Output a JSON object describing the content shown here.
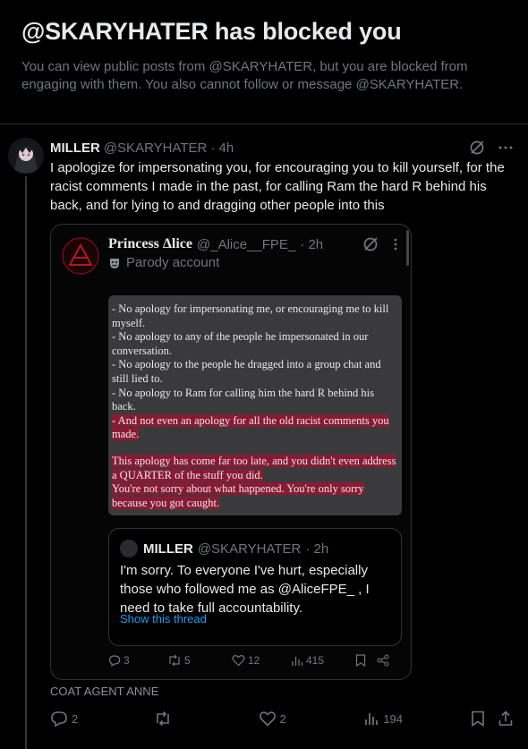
{
  "blocked": {
    "title": "@SKARYHATER has blocked you",
    "message": "You can view public posts from @SKARYHATER, but you are blocked from engaging with them. You also cannot follow or message @SKARYHATER."
  },
  "post": {
    "author_name": "MILLER",
    "author_handle": "@SKARYHATER",
    "time": "· 4h",
    "text": "I apologize for impersonating you, for encouraging you to kill yourself, for the racist comments I made in the past, for calling Ram the hard R behind his back, and for lying to and dragging other people into this",
    "attribution": "COAT AGENT ANNE",
    "counts": {
      "replies": "2",
      "likes": "2",
      "views": "194"
    }
  },
  "quoted": {
    "author_name": "Princess Δlice",
    "author_handle": "@_Alice__FPE_",
    "time": "· 2h",
    "badge": "Parody account",
    "notes": [
      {
        "text": "- No apology for impersonating me, or encouraging me to kill myself.",
        "highlight": false
      },
      {
        "text": "- No apology to any of the people he impersonated in our conversation.",
        "highlight": false
      },
      {
        "text": "- No apology to the people he dragged into a group chat and still lied to.",
        "highlight": false
      },
      {
        "text": "- No apology to Ram for calling him the hard R behind his back.",
        "highlight": false
      },
      {
        "text": "- And not even an apology for all the old racist comments you made.",
        "highlight": true
      },
      {
        "text": "This apology has come far too late, and you didn't even address a QUARTER of the stuff you did.",
        "highlight": true
      },
      {
        "text": "You're not sorry about what happened. You're only sorry because you got caught.",
        "highlight": true
      }
    ],
    "inner": {
      "author_name": "MILLER",
      "author_handle": "@SKARYHATER",
      "time": "· 2h",
      "text": "I'm sorry. To everyone I've hurt, especially those who followed me as @AliceFPE_ , I need to take full accountability.",
      "show_thread": "Show this thread"
    },
    "counts": {
      "replies": "3",
      "reposts": "5",
      "likes": "12",
      "views": "415"
    }
  },
  "colors": {
    "background": "#000000",
    "accent": "#1d9bf0",
    "highlight": "#8a1a33",
    "muted": "#71767b"
  }
}
